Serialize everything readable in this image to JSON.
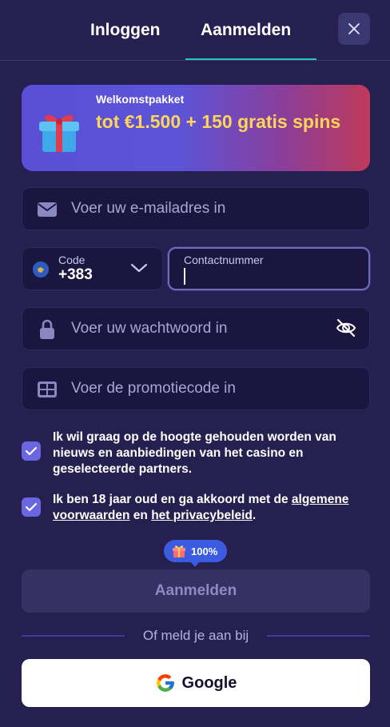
{
  "header": {
    "tabs": [
      {
        "label": "Inloggen",
        "active": false
      },
      {
        "label": "Aanmelden",
        "active": true
      }
    ],
    "close_icon": "close-icon"
  },
  "banner": {
    "label": "Welkomstpakket",
    "offer": "tot €1.500 + 150 gratis spins",
    "icon": "gift-icon"
  },
  "form": {
    "email_placeholder": "Voer uw e-mailadres in",
    "code_label": "Code",
    "code_value": "+383",
    "contact_label": "Contactnummer",
    "contact_value": "",
    "password_placeholder": "Voer uw wachtwoord in",
    "promo_placeholder": "Voer de promotiecode in"
  },
  "consents": {
    "newsletter": {
      "checked": true,
      "text": "Ik wil graag op de hoogte gehouden worden van nieuws en aanbiedingen van het casino en geselecteerde partners."
    },
    "terms": {
      "checked": true,
      "text_before": "Ik ben 18 jaar oud en ga akkoord met de",
      "terms_link": "algemene voorwaarden",
      "text_and": "en",
      "privacy_link": "het privacybeleid",
      "text_end": "."
    }
  },
  "bonus_indicator": {
    "value": "100%"
  },
  "submit_label": "Aanmelden",
  "divider_text": "Of meld je aan bij",
  "social": {
    "google_label": "Google"
  },
  "colors": {
    "background": "#25204f",
    "field": "#1a1640",
    "accent": "#6a65e0",
    "tab_underline": "#27c6c0",
    "offer_text": "#ffd45a"
  }
}
